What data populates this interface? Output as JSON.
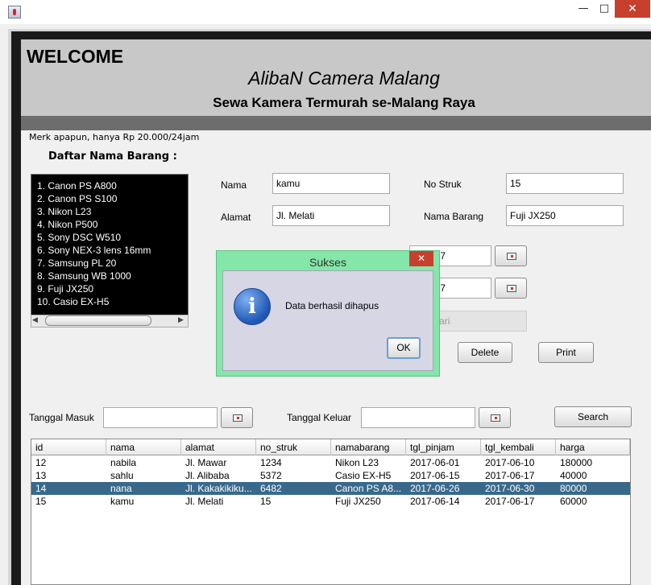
{
  "window": {
    "min_symbol": "—",
    "max_symbol": "□",
    "close_symbol": "✕",
    "icon": "java-cup-icon"
  },
  "header": {
    "welcome": "WELCOME",
    "company": "AlibaN Camera Malang",
    "tagline": "Sewa Kamera Termurah se-Malang Raya"
  },
  "note": "Merk apapun, hanya Rp 20.000/24jam",
  "items_title": "Daftar Nama Barang :",
  "items": [
    "1. Canon PS A800",
    "2. Canon PS S100",
    "3. Nikon L23",
    "4. Nikon P500",
    "5. Sony DSC W510",
    "6. Sony NEX-3 lens 16mm",
    "7. Samsung PL 20",
    "8. Samsung WB 1000",
    "9. Fuji JX250",
    "10. Casio EX-H5"
  ],
  "form": {
    "nama_label": "Nama",
    "nama_value": "kamu",
    "alamat_label": "Alamat",
    "alamat_value": "Jl. Melati",
    "nostruk_label": "No Struk",
    "nostruk_value": "15",
    "namabarang_label": "Nama Barang",
    "namabarang_value": "Fuji JX250",
    "tgl_pinjam_partial": "4, 2017",
    "tgl_kembali_partial": "7, 2017",
    "harga_partial": "000/Hari"
  },
  "buttons": {
    "delete": "Delete",
    "print": "Print",
    "search": "Search"
  },
  "filter": {
    "masuk_label": "Tanggal Masuk",
    "masuk_value": "",
    "keluar_label": "Tanggal Keluar",
    "keluar_value": ""
  },
  "table": {
    "columns": [
      "id",
      "nama",
      "alamat",
      "no_struk",
      "namabarang",
      "tgl_pinjam",
      "tgl_kembali",
      "harga"
    ],
    "rows": [
      {
        "c": [
          "12",
          "nabila",
          "Jl. Mawar",
          "1234",
          "Nikon L23",
          "2017-06-01",
          "2017-06-10",
          "180000"
        ],
        "selected": false
      },
      {
        "c": [
          "13",
          "sahlu",
          "Jl. Alibaba",
          "5372",
          "Casio EX-H5",
          "2017-06-15",
          "2017-06-17",
          "40000"
        ],
        "selected": false
      },
      {
        "c": [
          "14",
          "nana",
          "Jl. Kakakikiku...",
          "6482",
          "Canon PS A8...",
          "2017-06-26",
          "2017-06-30",
          "80000"
        ],
        "selected": true
      },
      {
        "c": [
          "15",
          "kamu",
          "Jl. Melati",
          "15",
          "Fuji JX250",
          "2017-06-14",
          "2017-06-17",
          "60000"
        ],
        "selected": false
      }
    ]
  },
  "dialog": {
    "title": "Sukses",
    "message": "Data berhasil dihapus",
    "ok": "OK",
    "close_symbol": "✕",
    "icon_glyph": "i"
  },
  "colors": {
    "selected_row": "#39698a",
    "dialog_frame": "#84e6a8",
    "close_red": "#c7402d"
  }
}
